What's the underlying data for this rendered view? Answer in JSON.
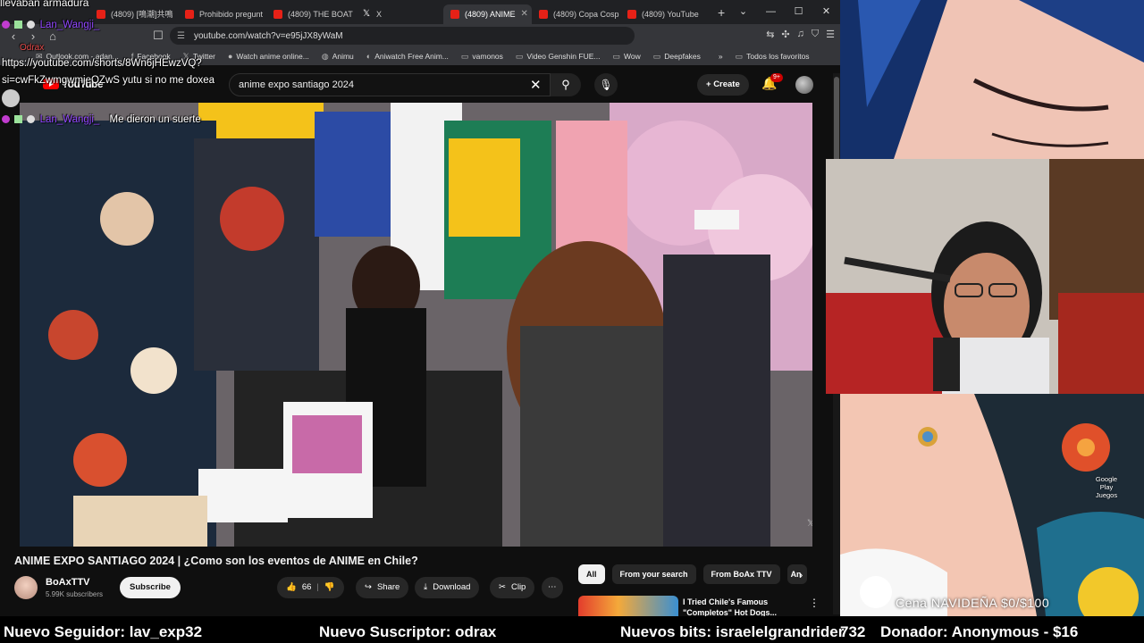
{
  "browser": {
    "tabs": [
      {
        "label": "(4809) [鳴潮]共鳴",
        "icon": "youtube-icon",
        "active": false
      },
      {
        "label": "Prohibido pregunt",
        "icon": "youtube-icon",
        "active": false
      },
      {
        "label": "(4809) THE BOAT T",
        "icon": "youtube-icon",
        "active": false
      },
      {
        "label": "X",
        "icon": "x-icon",
        "active": false
      },
      {
        "label": "(4809) ANIME",
        "icon": "youtube-icon",
        "active": true
      },
      {
        "label": "(4809) Copa Cosp",
        "icon": "youtube-icon",
        "active": false
      },
      {
        "label": "(4809) YouTube",
        "icon": "youtube-icon",
        "active": false
      }
    ],
    "url": "youtube.com/watch?v=e95jJX8yWaM",
    "bookmarks": [
      {
        "label": "Outlook.com - adan...",
        "icon": "mail-icon"
      },
      {
        "label": "Facebook",
        "icon": "facebook-icon"
      },
      {
        "label": "Twitter",
        "icon": "x-icon"
      },
      {
        "label": "Watch anime online...",
        "icon": "anime-icon"
      },
      {
        "label": "Animu",
        "icon": "globe-icon"
      },
      {
        "label": "Aniwatch Free Anim...",
        "icon": "anime-icon"
      },
      {
        "label": "vamonos",
        "icon": "folder-icon"
      },
      {
        "label": "Video Genshin FUE...",
        "icon": "folder-icon"
      },
      {
        "label": "Wow",
        "icon": "folder-icon"
      },
      {
        "label": "Deepfakes",
        "icon": "folder-icon"
      }
    ],
    "bookmarks_more": "»",
    "all_bookmarks": "Todos los favoritos"
  },
  "youtube": {
    "logo": "YouTube",
    "search_value": "anime expo santiago 2024",
    "create_label": "Create",
    "notif_count": "9+",
    "video_title": "ANIME EXPO SANTIAGO 2024 | ¿Como son los eventos de ANIME en Chile?",
    "channel_name": "BoAxTTV",
    "channel_subs": "5.99K subscribers",
    "subscribe_label": "Subscribe",
    "likes": "66",
    "share_label": "Share",
    "download_label": "Download",
    "clip_label": "Clip",
    "chips": [
      "All",
      "From your search",
      "From BoAx TTV",
      "An"
    ],
    "rec_title": "I Tried Chile's Famous \"Completos\" Hot Dogs..."
  },
  "chat": {
    "top_text": "llevaban armadura",
    "user1": "Lan_Wangji_",
    "user2": "Odrax",
    "msg_link_1": "https://youtube.com/shorts/8Wn6jHEwzVQ?",
    "msg_link_2": "si=cwFkZwmgwmjeQZwS yutu si no me doxea",
    "user3": "Lan_Wangji_",
    "msg3": "Me dieron un suerte"
  },
  "overlay": {
    "google_play": "Google Play Juegos",
    "goal": "Cena NAVIDEÑA $0/$100",
    "ticker": [
      "Nuevo Seguidor: lav_exp32",
      "Nuevo Suscriptor: odrax",
      "Nuevos bits: israelelgrandrider",
      "732",
      "Donador: Anonymous - $16"
    ]
  },
  "colors": {
    "yt_red": "#ff0000",
    "twitch_purple": "#9147ff",
    "browser_dark": "#202124"
  }
}
